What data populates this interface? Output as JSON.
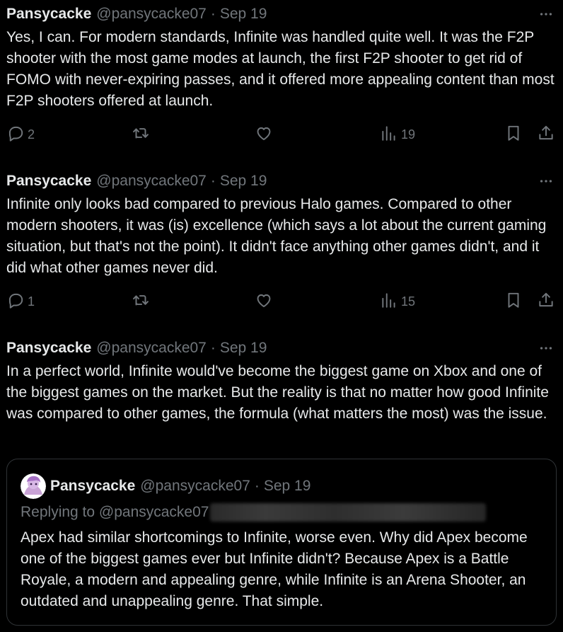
{
  "colors": {
    "background": "#000000",
    "text": "#e7e9ea",
    "muted": "#71767b",
    "border": "#2f3336"
  },
  "tweets": [
    {
      "name": "Pansycacke",
      "handle": "@pansycacke07",
      "separator": "·",
      "date": "Sep 19",
      "text": "Yes, I can. For modern standards, Infinite was handled quite well. It was the F2P shooter with the most game modes at launch, the first F2P shooter to get rid of FOMO with never-expiring passes, and it offered more appealing content than most F2P shooters offered at launch.",
      "replies": "2",
      "views": "19"
    },
    {
      "name": "Pansycacke",
      "handle": "@pansycacke07",
      "separator": "·",
      "date": "Sep 19",
      "text": "Infinite only looks bad compared to previous Halo games. Compared to other modern shooters, it was (is) excellence (which says a lot about the current gaming situation, but that's not the point). It didn't face anything other games didn't, and it did what other games never did.",
      "replies": "1",
      "views": "15"
    },
    {
      "name": "Pansycacke",
      "handle": "@pansycacke07",
      "separator": "·",
      "date": "Sep 19",
      "text": "In a perfect world, Infinite would've become the biggest game on Xbox and one of the biggest games on the market. But the reality is that no matter how good Infinite was compared to other games, the formula (what matters the most) was the issue."
    }
  ],
  "quote": {
    "name": "Pansycacke",
    "handle": "@pansycacke07",
    "separator": "·",
    "date": "Sep 19",
    "replying_to": "Replying to @pansycacke07",
    "text": "Apex had similar shortcomings to Infinite, worse even. Why did Apex become one of the biggest games ever but Infinite didn't? Because Apex is a Battle Royale, a modern and appealing genre, while Infinite is an Arena Shooter, an outdated and unappealing genre. That simple."
  },
  "icons": {
    "reply": "reply-icon",
    "retweet": "retweet-icon",
    "like": "like-icon",
    "views": "views-icon",
    "bookmark": "bookmark-icon",
    "share": "share-icon",
    "more": "more-icon"
  }
}
